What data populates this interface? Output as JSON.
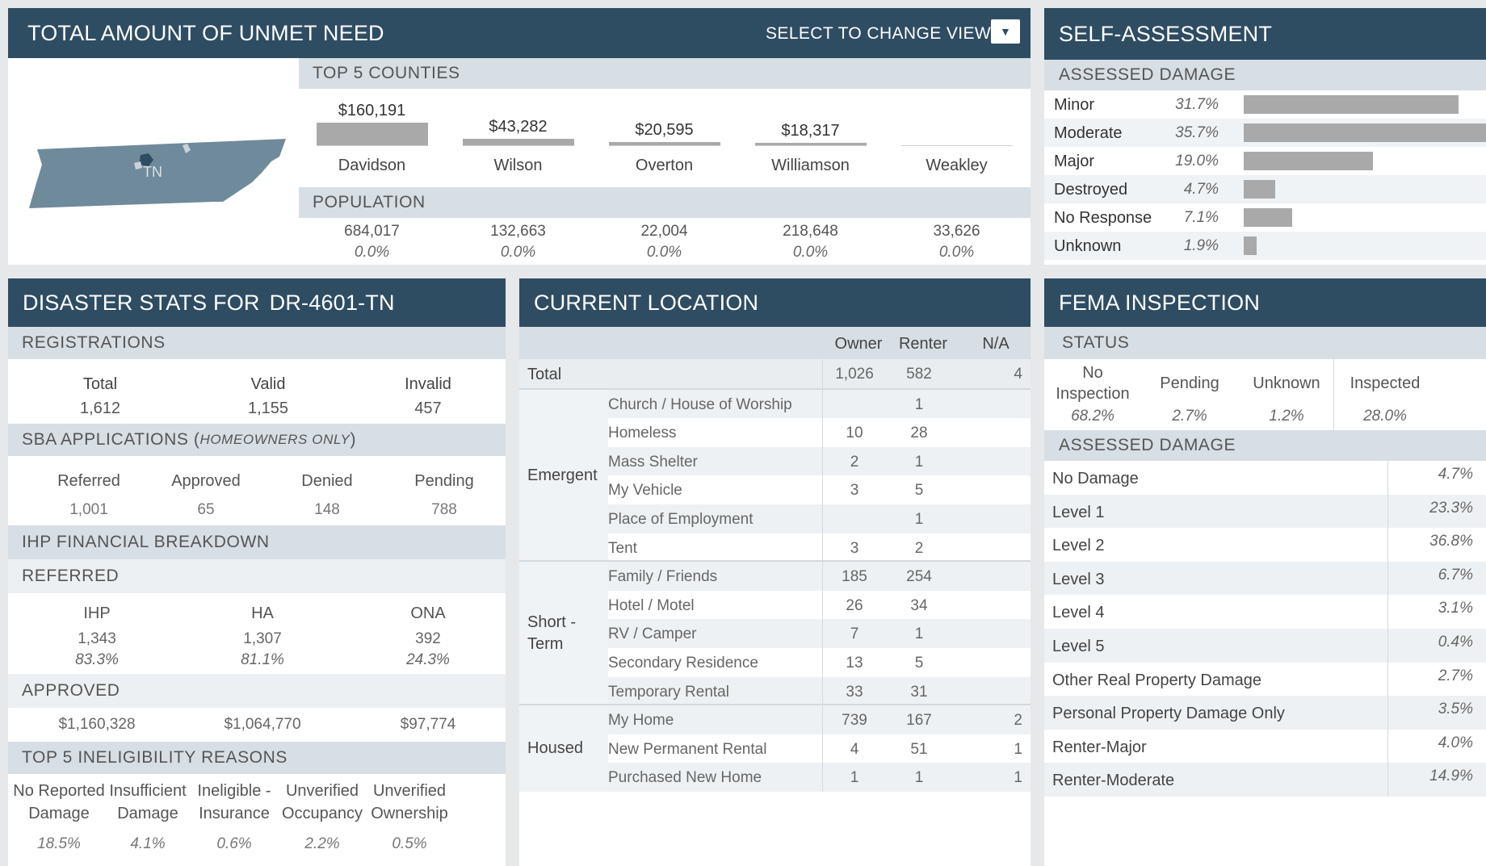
{
  "unmet": {
    "title": "TOTAL AMOUNT OF UNMET NEED",
    "select_label": "SELECT TO CHANGE VIEW",
    "map_label": "TN",
    "counties_header": "TOP 5 COUNTIES",
    "population_header": "POPULATION",
    "counties": [
      {
        "amount": "$160,191",
        "name": "Davidson",
        "population": "684,017",
        "pct": "0.0%",
        "bar": 1.0
      },
      {
        "amount": "$43,282",
        "name": "Wilson",
        "population": "132,663",
        "pct": "0.0%",
        "bar": 0.27
      },
      {
        "amount": "$20,595",
        "name": "Overton",
        "population": "22,004",
        "pct": "0.0%",
        "bar": 0.13
      },
      {
        "amount": "$18,317",
        "name": "Williamson",
        "population": "218,648",
        "pct": "0.0%",
        "bar": 0.11
      },
      {
        "amount": "",
        "name": "Weakley",
        "population": "33,626",
        "pct": "0.0%",
        "bar": 0
      }
    ]
  },
  "self": {
    "title": "SELF-ASSESSMENT",
    "sub": "ASSESSED DAMAGE",
    "rows": [
      {
        "label": "Minor",
        "pct": "31.7%",
        "value": 31.7
      },
      {
        "label": "Moderate",
        "pct": "35.7%",
        "value": 35.7
      },
      {
        "label": "Major",
        "pct": "19.0%",
        "value": 19.0
      },
      {
        "label": "Destroyed",
        "pct": "4.7%",
        "value": 4.7
      },
      {
        "label": "No Response",
        "pct": "7.1%",
        "value": 7.1
      },
      {
        "label": "Unknown",
        "pct": "1.9%",
        "value": 1.9
      }
    ]
  },
  "stats": {
    "title_prefix": "DISASTER STATS FOR",
    "disaster_id": "DR-4601-TN",
    "registrations": {
      "header": "REGISTRATIONS",
      "labels": [
        "Total",
        "Valid",
        "Invalid"
      ],
      "values": [
        "1,612",
        "1,155",
        "457"
      ]
    },
    "sba": {
      "header": "SBA APPLICATIONS (",
      "header_note": "HOMEOWNERS ONLY",
      "header_close": ")",
      "labels": [
        "Referred",
        "Approved",
        "Denied",
        "Pending"
      ],
      "values": [
        "1,001",
        "65",
        "148",
        "788"
      ]
    },
    "ihp": {
      "header": "IHP FINANCIAL BREAKDOWN",
      "referred_header": "REFERRED",
      "labels": [
        "IHP",
        "HA",
        "ONA"
      ],
      "values": [
        "1,343",
        "1,307",
        "392"
      ],
      "pcts": [
        "83.3%",
        "81.1%",
        "24.3%"
      ],
      "approved_header": "APPROVED",
      "approved": [
        "$1,160,328",
        "$1,064,770",
        "$97,774"
      ]
    },
    "inelig": {
      "header": "TOP 5 INELIGIBILITY REASONS",
      "items": [
        {
          "l1": "No Reported",
          "l2": "Damage",
          "pct": "18.5%"
        },
        {
          "l1": "Insufficient",
          "l2": "Damage",
          "pct": "4.1%"
        },
        {
          "l1": "Ineligible -",
          "l2": "Insurance",
          "pct": "0.6%"
        },
        {
          "l1": "Unverified",
          "l2": "Occupancy",
          "pct": "2.2%"
        },
        {
          "l1": "Unverified",
          "l2": "Ownership",
          "pct": "0.5%"
        }
      ]
    }
  },
  "location": {
    "title": "CURRENT LOCATION",
    "cols": [
      "Owner",
      "Renter",
      "N/A"
    ],
    "total": {
      "label": "Total",
      "owner": "1,026",
      "renter": "582",
      "na": "4"
    },
    "groups": [
      {
        "label": "Emergent",
        "rows": [
          {
            "label": "Church / House of Worship",
            "owner": "",
            "renter": "1",
            "na": ""
          },
          {
            "label": "Homeless",
            "owner": "10",
            "renter": "28",
            "na": ""
          },
          {
            "label": "Mass Shelter",
            "owner": "2",
            "renter": "1",
            "na": ""
          },
          {
            "label": "My Vehicle",
            "owner": "3",
            "renter": "5",
            "na": ""
          },
          {
            "label": "Place of Employment",
            "owner": "",
            "renter": "1",
            "na": ""
          },
          {
            "label": "Tent",
            "owner": "3",
            "renter": "2",
            "na": ""
          }
        ]
      },
      {
        "label": "Short - Term",
        "label1": "Short -",
        "label2": "Term",
        "rows": [
          {
            "label": "Family / Friends",
            "owner": "185",
            "renter": "254",
            "na": ""
          },
          {
            "label": "Hotel / Motel",
            "owner": "26",
            "renter": "34",
            "na": ""
          },
          {
            "label": "RV / Camper",
            "owner": "7",
            "renter": "1",
            "na": ""
          },
          {
            "label": "Secondary Residence",
            "owner": "13",
            "renter": "5",
            "na": ""
          },
          {
            "label": "Temporary Rental",
            "owner": "33",
            "renter": "31",
            "na": ""
          }
        ]
      },
      {
        "label": "Housed",
        "rows": [
          {
            "label": "My Home",
            "owner": "739",
            "renter": "167",
            "na": "2"
          },
          {
            "label": "New Permanent Rental",
            "owner": "4",
            "renter": "51",
            "na": "1"
          },
          {
            "label": "Purchased New Home",
            "owner": "1",
            "renter": "1",
            "na": "1"
          }
        ]
      }
    ]
  },
  "fema": {
    "title": "FEMA INSPECTION",
    "status_header": "STATUS",
    "status": [
      {
        "label": "No Inspection",
        "l1": "No",
        "l2": "Inspection",
        "pct": "68.2%"
      },
      {
        "label": "Pending",
        "pct": "2.7%"
      },
      {
        "label": "Unknown",
        "pct": "1.2%"
      },
      {
        "label": "Inspected",
        "pct": "28.0%"
      }
    ],
    "damage_header": "ASSESSED DAMAGE",
    "damage": [
      {
        "label": "No Damage",
        "pct": "4.7%"
      },
      {
        "label": "Level 1",
        "pct": "23.3%"
      },
      {
        "label": "Level 2",
        "pct": "36.8%"
      },
      {
        "label": "Level 3",
        "pct": "6.7%"
      },
      {
        "label": "Level 4",
        "pct": "3.1%"
      },
      {
        "label": "Level 5",
        "pct": "0.4%"
      },
      {
        "label": "Other Real Property Damage",
        "pct": "2.7%"
      },
      {
        "label": "Personal Property Damage Only",
        "pct": "3.5%"
      },
      {
        "label": "Renter-Major",
        "pct": "4.0%"
      },
      {
        "label": "Renter-Moderate",
        "pct": "14.9%"
      }
    ]
  }
}
